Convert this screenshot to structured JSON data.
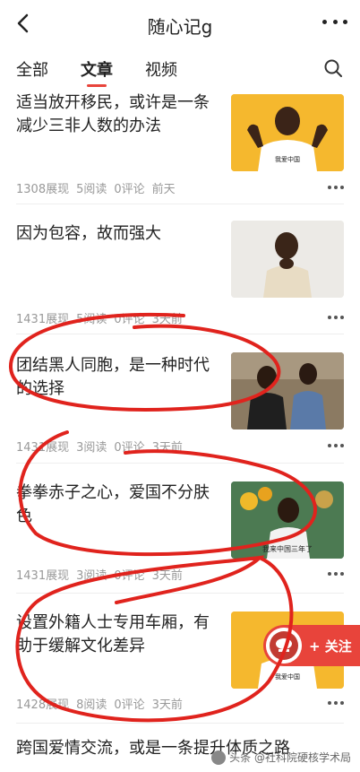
{
  "header": {
    "title": "随心记g"
  },
  "tabs": [
    {
      "label": "全部"
    },
    {
      "label": "文章"
    },
    {
      "label": "视频"
    }
  ],
  "articles": [
    {
      "title": "适当放开移民，或许是一条减少三非人数的办法",
      "views": "1308展现",
      "reads": "5阅读",
      "comments": "0评论",
      "time": "前天",
      "thumb_caption": "我爱中国"
    },
    {
      "title": "因为包容，故而强大",
      "views": "1431展现",
      "reads": "5阅读",
      "comments": "0评论",
      "time": "3天前",
      "thumb_caption": ""
    },
    {
      "title": "团结黑人同胞，是一种时代的选择",
      "views": "1431展现",
      "reads": "3阅读",
      "comments": "0评论",
      "time": "3天前",
      "thumb_caption": ""
    },
    {
      "title": "拳拳赤子之心，爱国不分肤色",
      "views": "1431展现",
      "reads": "3阅读",
      "comments": "0评论",
      "time": "3天前",
      "thumb_caption": "我来中国三年了"
    },
    {
      "title": "设置外籍人士专用车厢，有助于缓解文化差异",
      "views": "1428展现",
      "reads": "8阅读",
      "comments": "0评论",
      "time": "3天前",
      "thumb_caption": "我爱中国"
    },
    {
      "title": "跨国爱情交流，或是一条提升体质之路",
      "views": "",
      "reads": "",
      "comments": "",
      "time": "",
      "thumb_caption": ""
    }
  ],
  "follow_button": {
    "label": "+ 关注"
  },
  "watermark": {
    "text": "头条 @社科院硬核学术局"
  },
  "colors": {
    "accent": "#e8443b",
    "meta": "#999999",
    "thumb_yellow": "#f5b82e"
  }
}
